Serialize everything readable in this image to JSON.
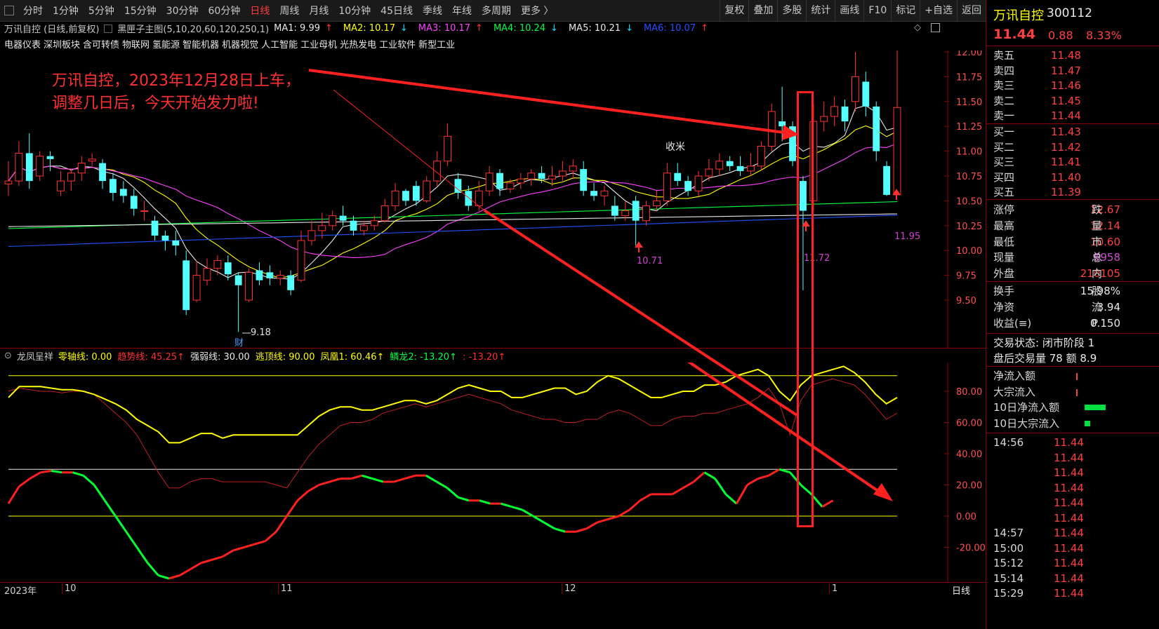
{
  "toolbar": {
    "timeframes": [
      "分时",
      "1分钟",
      "5分钟",
      "15分钟",
      "30分钟",
      "60分钟",
      "日线",
      "周线",
      "月线",
      "10分钟",
      "45日线",
      "季线",
      "年线",
      "多周期",
      "更多 〉"
    ],
    "active_timeframe": "日线",
    "right_buttons": [
      "复权",
      "叠加",
      "多股",
      "统计",
      "画线",
      "F10",
      "标记",
      "+自选",
      "返回"
    ]
  },
  "infobar": {
    "stock_title": "万讯自控 (日线,前复权)",
    "main_indicator": "黑匣子主图(5,10,20,60,120,250,1)",
    "ma": [
      {
        "label": "MA1: 9.99",
        "arrow": "↑",
        "color": "#e8e8e8"
      },
      {
        "label": "MA2: 10.17",
        "arrow": "↓",
        "color": "#ffff00"
      },
      {
        "label": "MA3: 10.17",
        "arrow": "↑",
        "color": "#ff40ff"
      },
      {
        "label": "MA4: 10.24",
        "arrow": "↓",
        "color": "#00ff40"
      },
      {
        "label": "MA5: 10.21",
        "arrow": "↓",
        "color": "#e8e8e8"
      },
      {
        "label": "MA6: 10.07",
        "arrow": "↑",
        "color": "#2050ff"
      }
    ]
  },
  "sectors": [
    "电器仪表",
    "深圳板块",
    "含可转债",
    "物联网",
    "氢能源",
    "智能机器",
    "机器视觉",
    "人工智能",
    "工业母机",
    "光热发电",
    "工业软件",
    "新型工业"
  ],
  "annotation": {
    "line1": "万讯自控，2023年12月28日上车，",
    "line2": "调整几日后，今天开始发力啦!",
    "shoumi": "收米"
  },
  "price_labels": {
    "high": "12.14",
    "low": "9.18",
    "low_mark": "10.71",
    "mark_1172": "11.72",
    "mark_1195": "11.95",
    "cai": "财"
  },
  "price_axis": [
    "12.00",
    "11.75",
    "11.50",
    "11.25",
    "11.00",
    "10.75",
    "10.50",
    "10.25",
    "10.00",
    "9.75",
    "9.50"
  ],
  "indicator": {
    "name": "龙凤呈祥",
    "items": [
      {
        "label": "零轴线: 0.00",
        "color": "#ffff00"
      },
      {
        "label": "趋势线: 45.25↑",
        "color": "#ff3030"
      },
      {
        "label": "强弱线: 30.00",
        "color": "#e8e8e8"
      },
      {
        "label": "逃顶线: 90.00",
        "color": "#ffff00"
      },
      {
        "label": "凤凰1: 60.46↑",
        "color": "#ffff00"
      },
      {
        "label": "鳞龙2: -13.20↑",
        "color": "#00ff40"
      },
      {
        "label": ": -13.20↑",
        "color": "#ff3030"
      }
    ],
    "axis": [
      "80.00",
      "60.00",
      "40.00",
      "20.00",
      "0.00",
      "-20.00"
    ]
  },
  "dates": [
    "2023年",
    "10",
    "11",
    "12",
    "1"
  ],
  "bottom_tab": "日线",
  "right_panel": {
    "name": "万讯自控",
    "code": "300112",
    "price": "11.44",
    "change": "0.88",
    "pct": "8.33%",
    "sells": [
      {
        "label": "卖五",
        "price": "11.48"
      },
      {
        "label": "卖四",
        "price": "11.47"
      },
      {
        "label": "卖三",
        "price": "11.46"
      },
      {
        "label": "卖二",
        "price": "11.45"
      },
      {
        "label": "卖一",
        "price": "11.44"
      }
    ],
    "buys": [
      {
        "label": "买一",
        "price": "11.43"
      },
      {
        "label": "买二",
        "price": "11.42"
      },
      {
        "label": "买三",
        "price": "11.41"
      },
      {
        "label": "买四",
        "price": "11.40"
      },
      {
        "label": "买五",
        "price": "11.39"
      }
    ],
    "stats": [
      {
        "label": "涨停",
        "value": "12.67",
        "color": "#ff4040",
        "extra": "跌"
      },
      {
        "label": "最高",
        "value": "12.14",
        "color": "#ff4040",
        "extra": "量"
      },
      {
        "label": "最低",
        "value": "10.60",
        "color": "#ff4040",
        "extra": "市"
      },
      {
        "label": "现量",
        "value": "6958",
        "color": "#d04ad0",
        "extra": "总"
      },
      {
        "label": "外盘",
        "value": "210105",
        "color": "#ff4040",
        "extra": "内"
      }
    ],
    "stats2": [
      {
        "label": "换手",
        "value": "15.98%",
        "extra": "股"
      },
      {
        "label": "净资",
        "value": "3.94",
        "extra": "流"
      },
      {
        "label": "收益(≡)",
        "value": "0.150",
        "extra": "P"
      }
    ],
    "trade_state": "交易状态: 闭市阶段 1",
    "after_hours": "盘后交易量 78 额 8.9",
    "flows": [
      "净流入额",
      "大宗流入",
      "10日净流入额",
      "10日大宗流入"
    ],
    "ticks": [
      {
        "time": "14:56",
        "price": "11.44"
      },
      {
        "time": "",
        "price": "11.44"
      },
      {
        "time": "",
        "price": "11.44"
      },
      {
        "time": "",
        "price": "11.44"
      },
      {
        "time": "",
        "price": "11.44"
      },
      {
        "time": "",
        "price": "11.44"
      },
      {
        "time": "14:57",
        "price": "11.44"
      },
      {
        "time": "15:00",
        "price": "11.44"
      },
      {
        "time": "15:12",
        "price": "11.44"
      },
      {
        "time": "15:14",
        "price": "11.44"
      },
      {
        "time": "15:29",
        "price": "11.44"
      }
    ]
  },
  "chart_data": [
    {
      "type": "candlestick",
      "title": "万讯自控 (日线,前复权)",
      "ylim": [
        9.2,
        12.2
      ],
      "y_ticks": [
        9.5,
        9.75,
        10.0,
        10.25,
        10.5,
        10.75,
        11.0,
        11.25,
        11.5,
        11.75,
        12.0
      ],
      "x_labels": [
        "2023年",
        "10",
        "11",
        "12",
        "1"
      ],
      "candles": [
        {
          "o": 10.67,
          "c": 10.7,
          "h": 10.9,
          "l": 10.55
        },
        {
          "o": 10.7,
          "c": 10.98,
          "h": 11.1,
          "l": 10.65
        },
        {
          "o": 10.98,
          "c": 10.7,
          "h": 11.18,
          "l": 10.62
        },
        {
          "o": 10.75,
          "c": 10.95,
          "h": 11.0,
          "l": 10.7
        },
        {
          "o": 10.95,
          "c": 10.92,
          "h": 11.0,
          "l": 10.8
        },
        {
          "o": 10.6,
          "c": 10.7,
          "h": 10.8,
          "l": 10.55
        },
        {
          "o": 10.7,
          "c": 10.78,
          "h": 10.82,
          "l": 10.6
        },
        {
          "o": 10.78,
          "c": 10.88,
          "h": 10.95,
          "l": 10.7
        },
        {
          "o": 10.9,
          "c": 10.92,
          "h": 10.98,
          "l": 10.85
        },
        {
          "o": 10.88,
          "c": 10.7,
          "h": 10.92,
          "l": 10.62
        },
        {
          "o": 10.72,
          "c": 10.58,
          "h": 10.78,
          "l": 10.5
        },
        {
          "o": 10.62,
          "c": 10.55,
          "h": 10.7,
          "l": 10.48
        },
        {
          "o": 10.55,
          "c": 10.42,
          "h": 10.62,
          "l": 10.35
        },
        {
          "o": 10.4,
          "c": 10.4,
          "h": 10.5,
          "l": 10.3
        },
        {
          "o": 10.3,
          "c": 10.15,
          "h": 10.35,
          "l": 10.1
        },
        {
          "o": 10.15,
          "c": 10.1,
          "h": 10.2,
          "l": 10.0
        },
        {
          "o": 10.1,
          "c": 10.05,
          "h": 10.2,
          "l": 9.95
        },
        {
          "o": 9.9,
          "c": 9.4,
          "h": 10.0,
          "l": 9.35
        },
        {
          "o": 9.5,
          "c": 9.75,
          "h": 9.9,
          "l": 9.48
        },
        {
          "o": 9.7,
          "c": 9.82,
          "h": 9.92,
          "l": 9.65
        },
        {
          "o": 9.82,
          "c": 9.9,
          "h": 9.95,
          "l": 9.75
        },
        {
          "o": 9.88,
          "c": 9.76,
          "h": 9.95,
          "l": 9.7
        },
        {
          "o": 9.75,
          "c": 9.65,
          "h": 9.78,
          "l": 9.18
        },
        {
          "o": 9.5,
          "c": 9.78,
          "h": 9.82,
          "l": 9.48
        },
        {
          "o": 9.8,
          "c": 9.7,
          "h": 9.88,
          "l": 9.65
        },
        {
          "o": 9.78,
          "c": 9.72,
          "h": 9.85,
          "l": 9.65
        },
        {
          "o": 9.72,
          "c": 9.75,
          "h": 9.8,
          "l": 9.65
        },
        {
          "o": 9.75,
          "c": 9.6,
          "h": 9.8,
          "l": 9.55
        },
        {
          "o": 9.7,
          "c": 10.1,
          "h": 10.2,
          "l": 9.68
        },
        {
          "o": 10.1,
          "c": 10.2,
          "h": 10.3,
          "l": 10.05
        },
        {
          "o": 10.2,
          "c": 10.25,
          "h": 10.38,
          "l": 10.12
        },
        {
          "o": 10.25,
          "c": 10.35,
          "h": 10.4,
          "l": 10.2
        },
        {
          "o": 10.35,
          "c": 10.3,
          "h": 10.45,
          "l": 10.25
        },
        {
          "o": 10.3,
          "c": 10.2,
          "h": 10.35,
          "l": 10.15
        },
        {
          "o": 10.2,
          "c": 10.25,
          "h": 10.3,
          "l": 10.15
        },
        {
          "o": 10.25,
          "c": 10.3,
          "h": 10.35,
          "l": 10.2
        },
        {
          "o": 10.3,
          "c": 10.45,
          "h": 10.52,
          "l": 10.28
        },
        {
          "o": 10.45,
          "c": 10.6,
          "h": 10.68,
          "l": 10.4
        },
        {
          "o": 10.6,
          "c": 10.5,
          "h": 10.62,
          "l": 10.45
        },
        {
          "o": 10.65,
          "c": 10.5,
          "h": 10.7,
          "l": 10.45
        },
        {
          "o": 10.5,
          "c": 10.7,
          "h": 10.75,
          "l": 10.48
        },
        {
          "o": 10.7,
          "c": 10.9,
          "h": 11.0,
          "l": 10.65
        },
        {
          "o": 10.9,
          "c": 11.15,
          "h": 11.28,
          "l": 10.85
        },
        {
          "o": 10.72,
          "c": 10.58,
          "h": 10.78,
          "l": 10.52
        },
        {
          "o": 10.6,
          "c": 10.45,
          "h": 10.65,
          "l": 10.4
        },
        {
          "o": 10.45,
          "c": 10.6,
          "h": 10.7,
          "l": 10.4
        },
        {
          "o": 10.6,
          "c": 10.78,
          "h": 10.85,
          "l": 10.55
        },
        {
          "o": 10.78,
          "c": 10.62,
          "h": 10.82,
          "l": 10.55
        },
        {
          "o": 10.62,
          "c": 10.68,
          "h": 10.72,
          "l": 10.58
        },
        {
          "o": 10.68,
          "c": 10.72,
          "h": 10.78,
          "l": 10.62
        },
        {
          "o": 10.72,
          "c": 10.78,
          "h": 10.82,
          "l": 10.65
        },
        {
          "o": 10.78,
          "c": 10.72,
          "h": 10.85,
          "l": 10.68
        },
        {
          "o": 10.72,
          "c": 10.75,
          "h": 10.85,
          "l": 10.65
        },
        {
          "o": 10.75,
          "c": 10.8,
          "h": 10.9,
          "l": 10.7
        },
        {
          "o": 10.8,
          "c": 10.85,
          "h": 10.92,
          "l": 10.72
        },
        {
          "o": 10.82,
          "c": 10.6,
          "h": 10.9,
          "l": 10.55
        },
        {
          "o": 10.6,
          "c": 10.55,
          "h": 10.68,
          "l": 10.5
        },
        {
          "o": 10.55,
          "c": 10.6,
          "h": 10.65,
          "l": 10.45
        },
        {
          "o": 10.45,
          "c": 10.35,
          "h": 10.55,
          "l": 10.3
        },
        {
          "o": 10.35,
          "c": 10.4,
          "h": 10.5,
          "l": 10.3
        },
        {
          "o": 10.5,
          "c": 10.3,
          "h": 10.55,
          "l": 10.05
        },
        {
          "o": 10.3,
          "c": 10.45,
          "h": 10.5,
          "l": 10.25
        },
        {
          "o": 10.45,
          "c": 10.5,
          "h": 10.6,
          "l": 10.4
        },
        {
          "o": 10.5,
          "c": 10.78,
          "h": 10.88,
          "l": 10.45
        },
        {
          "o": 10.78,
          "c": 10.7,
          "h": 10.88,
          "l": 10.65
        },
        {
          "o": 10.7,
          "c": 10.6,
          "h": 10.75,
          "l": 10.55
        },
        {
          "o": 10.6,
          "c": 10.75,
          "h": 10.8,
          "l": 10.55
        },
        {
          "o": 10.75,
          "c": 10.82,
          "h": 10.92,
          "l": 10.7
        },
        {
          "o": 10.82,
          "c": 10.9,
          "h": 10.98,
          "l": 10.75
        },
        {
          "o": 10.9,
          "c": 10.85,
          "h": 10.95,
          "l": 10.8
        },
        {
          "o": 10.85,
          "c": 10.8,
          "h": 10.95,
          "l": 10.75
        },
        {
          "o": 10.8,
          "c": 10.85,
          "h": 10.98,
          "l": 10.75
        },
        {
          "o": 10.85,
          "c": 11.05,
          "h": 11.1,
          "l": 10.8
        },
        {
          "o": 11.05,
          "c": 11.4,
          "h": 11.48,
          "l": 11.0
        },
        {
          "o": 11.3,
          "c": 11.25,
          "h": 11.65,
          "l": 11.1
        },
        {
          "o": 11.25,
          "c": 10.9,
          "h": 11.3,
          "l": 10.85
        },
        {
          "o": 10.7,
          "c": 10.4,
          "h": 10.75,
          "l": 9.6
        },
        {
          "o": 10.5,
          "c": 11.3,
          "h": 11.48,
          "l": 10.4
        },
        {
          "o": 11.3,
          "c": 11.35,
          "h": 11.5,
          "l": 11.2
        },
        {
          "o": 11.35,
          "c": 11.45,
          "h": 11.55,
          "l": 11.25
        },
        {
          "o": 11.45,
          "c": 11.3,
          "h": 11.52,
          "l": 11.2
        },
        {
          "o": 11.5,
          "c": 11.75,
          "h": 12.0,
          "l": 11.4
        },
        {
          "o": 11.7,
          "c": 11.45,
          "h": 11.8,
          "l": 11.35
        },
        {
          "o": 11.45,
          "c": 11.0,
          "h": 11.5,
          "l": 10.9
        },
        {
          "o": 10.85,
          "c": 10.56,
          "h": 10.9,
          "l": 10.55
        },
        {
          "o": 10.56,
          "c": 11.44,
          "h": 12.14,
          "l": 10.6
        }
      ],
      "ma_series": [
        {
          "name": "MA1",
          "color": "#e8e8e8"
        },
        {
          "name": "MA2",
          "color": "#ffff00"
        },
        {
          "name": "MA3",
          "color": "#ff40ff"
        },
        {
          "name": "MA4",
          "color": "#00ff40"
        },
        {
          "name": "MA5",
          "color": "#e8e8e8"
        },
        {
          "name": "MA6",
          "color": "#2050ff"
        }
      ]
    },
    {
      "type": "line",
      "title": "龙凤呈祥",
      "ylim": [
        -28,
        100
      ],
      "y_ticks": [
        -20,
        0,
        20,
        40,
        60,
        80
      ],
      "hlines": [
        90,
        30,
        0
      ],
      "series": [
        {
          "name": "凤凰1",
          "color": "#ffff00",
          "values": [
            76,
            83,
            83,
            83,
            82,
            81,
            81,
            80,
            78,
            75,
            72,
            68,
            62,
            58,
            54,
            47,
            47,
            50,
            53,
            53,
            50,
            52,
            52,
            52,
            52,
            52,
            52,
            52,
            58,
            64,
            68,
            70,
            70,
            68,
            68,
            70,
            72,
            74,
            74,
            72,
            74,
            78,
            82,
            84,
            82,
            80,
            80,
            76,
            76,
            78,
            80,
            82,
            82,
            78,
            80,
            86,
            90,
            88,
            84,
            80,
            76,
            76,
            78,
            80,
            80,
            84,
            84,
            86,
            90,
            92,
            94,
            90,
            80,
            74,
            84,
            90,
            92,
            94,
            96,
            92,
            86,
            78,
            72,
            76
          ]
        },
        {
          "name": "趋势线",
          "color": "#ff3030",
          "values": [
            80,
            82,
            81,
            80,
            80,
            79,
            80,
            80,
            78,
            72,
            66,
            60,
            52,
            40,
            28,
            18,
            18,
            22,
            24,
            24,
            22,
            22,
            22,
            22,
            22,
            20,
            18,
            28,
            38,
            46,
            52,
            58,
            60,
            60,
            62,
            66,
            68,
            70,
            72,
            70,
            72,
            74,
            76,
            78,
            76,
            74,
            72,
            68,
            66,
            64,
            62,
            62,
            60,
            60,
            62,
            62,
            66,
            68,
            66,
            62,
            58,
            58,
            62,
            64,
            64,
            66,
            66,
            68,
            70,
            72,
            76,
            82,
            72,
            52,
            74,
            84,
            86,
            88,
            86,
            84,
            78,
            70,
            62,
            66
          ]
        },
        {
          "name": "鳞龙2",
          "color": "#00ff40",
          "values": [
            8,
            19,
            24,
            28,
            29,
            28,
            28,
            26,
            20,
            10,
            0,
            -10,
            -20,
            -30,
            -38,
            -40,
            -38,
            -34,
            -30,
            -28,
            -26,
            -22,
            -20,
            -18,
            -16,
            -10,
            0,
            10,
            16,
            20,
            22,
            24,
            24,
            26,
            24,
            22,
            22,
            24,
            26,
            26,
            22,
            18,
            12,
            10,
            10,
            8,
            8,
            6,
            4,
            0,
            -4,
            -8,
            -10,
            -10,
            -8,
            -4,
            -2,
            0,
            4,
            10,
            14,
            14,
            14,
            18,
            22,
            28,
            24,
            14,
            8,
            20,
            24,
            26,
            30,
            28,
            20,
            14,
            6,
            10
          ]
        }
      ]
    }
  ]
}
